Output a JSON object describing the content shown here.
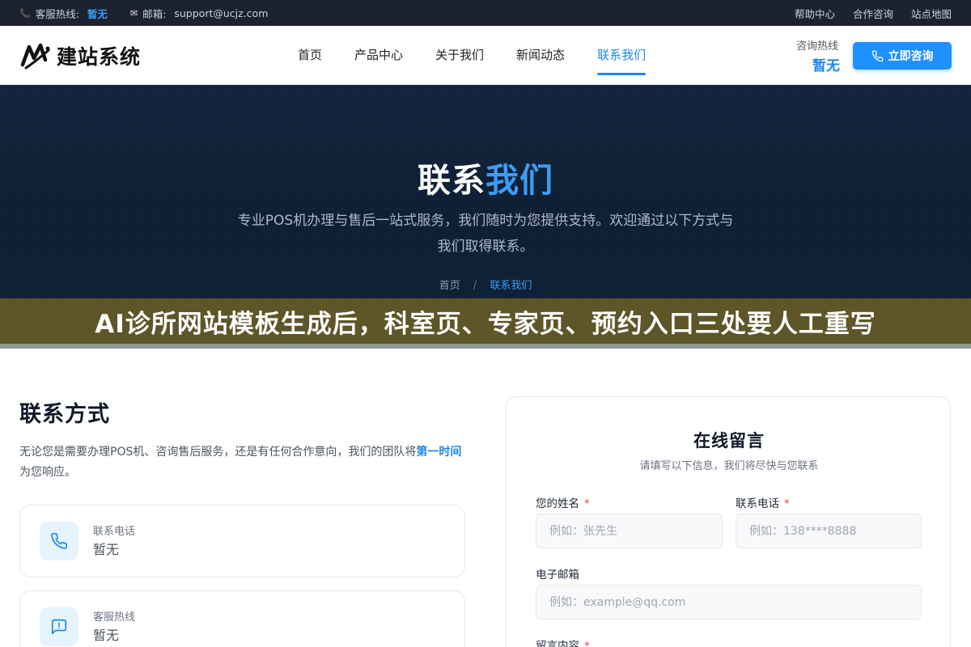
{
  "topbar": {
    "hotline_label": "客服热线:",
    "hotline_value": "暂无",
    "email_label": "邮箱:",
    "email_value": "support@ucjz.com",
    "links": [
      "帮助中心",
      "合作咨询",
      "站点地图"
    ]
  },
  "header": {
    "logo_text": "建站系统",
    "nav": [
      "首页",
      "产品中心",
      "关于我们",
      "新闻动态",
      "联系我们"
    ],
    "active_nav": "联系我们",
    "consult_label": "咨询热线",
    "consult_value": "暂无",
    "cta_label": "立即咨询"
  },
  "hero": {
    "title_main": "联系",
    "title_accent": "我们",
    "subtitle": "专业POS机办理与售后一站式服务，我们随时为您提供支持。欢迎通过以下方式与我们取得联系。",
    "breadcrumb_home": "首页",
    "breadcrumb_sep": "/",
    "breadcrumb_current": "联系我们"
  },
  "banner": {
    "text": "AI诊所网站模板生成后，科室页、专家页、预约入口三处要人工重写"
  },
  "contact": {
    "title": "联系方式",
    "desc_before": "无论您是需要办理POS机、咨询售后服务，还是有任何合作意向，我们的团队将",
    "desc_highlight": "第一时间",
    "desc_after": "为您响应。",
    "cards": [
      {
        "label": "联系电话",
        "value": "暂无",
        "icon": "phone-icon"
      },
      {
        "label": "客服热线",
        "value": "暂无",
        "icon": "message-icon"
      }
    ]
  },
  "form": {
    "title": "在线留言",
    "subtitle": "请填写以下信息，我们将尽快与您联系",
    "name_label": "您的姓名",
    "name_placeholder": "例如：张先生",
    "phone_label": "联系电话",
    "phone_placeholder": "例如：138****8888",
    "email_label": "电子邮箱",
    "email_placeholder": "例如：example@qq.com",
    "message_label": "留言内容",
    "required_mark": "*"
  },
  "colors": {
    "accent": "#1e88e5",
    "topbar_bg": "#1c2230",
    "hero_bg": "#0f2035",
    "banner_bg": "#5e5528"
  }
}
